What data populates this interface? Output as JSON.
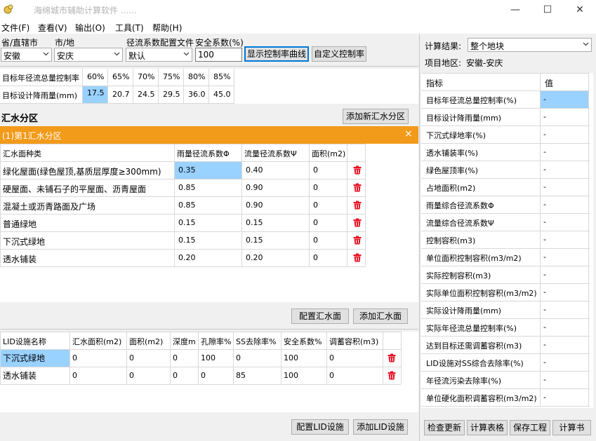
{
  "window": {
    "title": "海绵城市辅助计算软件",
    "title_suffix": "......",
    "minimize": "—",
    "maximize": "☐",
    "close": "✕"
  },
  "menu": [
    "文件(F)",
    "查看(V)",
    "输出(O)",
    "工具(T)",
    "帮助(H)"
  ],
  "toolbar": {
    "province_label": "省/直辖市",
    "province_value": "安徽",
    "city_label": "市/地",
    "city_value": "安庆",
    "coef_label": "径流系数配置文件",
    "coef_value": "默认",
    "safety_label": "安全系数(%)",
    "safety_value": "100",
    "show_curve_button": "显示控制率曲线",
    "custom_rate_button": "自定义控制率"
  },
  "target_table": {
    "row1_label": "目标年径流总量控制率",
    "row2_label": "目标设计降雨量(mm)",
    "rates": [
      "60%",
      "65%",
      "70%",
      "75%",
      "80%",
      "85%"
    ],
    "rainfall": [
      "17.5",
      "20.7",
      "24.5",
      "29.5",
      "36.0",
      "45.0"
    ]
  },
  "catchment": {
    "section_title": "汇水分区",
    "add_button": "添加新汇水分区",
    "zone_title": "(1)第1汇水分区",
    "close_glyph": "×"
  },
  "surface_table": {
    "headers": [
      "汇水面种类",
      "雨量径流系数Φ",
      "流量径流系数Ψ",
      "面积(m2)"
    ],
    "rows": [
      [
        "绿化屋面(绿色屋顶,基质层厚度≥300mm)",
        "0.35",
        "0.40",
        "0"
      ],
      [
        "硬屋面、未铺石子的平屋面、沥青屋面",
        "0.85",
        "0.90",
        "0"
      ],
      [
        "混凝土或沥青路面及广场",
        "0.85",
        "0.90",
        "0"
      ],
      [
        "普通绿地",
        "0.15",
        "0.15",
        "0"
      ],
      [
        "下沉式绿地",
        "0.15",
        "0.15",
        "0"
      ],
      [
        "透水铺装",
        "0.20",
        "0.20",
        "0"
      ]
    ],
    "config_button": "配置汇水面",
    "add_button": "添加汇水面"
  },
  "lid_table": {
    "headers": [
      "LID设施名称",
      "汇水面积(m2)",
      "面积(m2)",
      "深度m",
      "孔隙率%",
      "SS去除率%",
      "安全系数%",
      "调蓄容积(m3)"
    ],
    "rows": [
      [
        "下沉式绿地",
        "0",
        "0",
        "0",
        "100",
        "0",
        "100",
        "0"
      ],
      [
        "透水铺装",
        "0",
        "0",
        "0",
        "0",
        "85",
        "100",
        "0"
      ]
    ],
    "config_button": "配置LID设施",
    "add_button": "添加LID设施"
  },
  "results": {
    "result_label": "计算结果:",
    "result_value": "整个地块",
    "area_label": "项目地区:",
    "area_value": "安徽-安庆",
    "col_index": "指标",
    "col_value": "值",
    "rows": [
      [
        "目标年径流总量控制率(%)",
        "-"
      ],
      [
        "目标设计降雨量(mm)",
        "-"
      ],
      [
        "下沉式绿地率(%)",
        "-"
      ],
      [
        "透水铺装率(%)",
        "-"
      ],
      [
        "绿色屋顶率(%)",
        "-"
      ],
      [
        "占地面积(m2)",
        "-"
      ],
      [
        "雨量综合径流系数Φ",
        "-"
      ],
      [
        "流量综合径流系数Ψ",
        "-"
      ],
      [
        "控制容积(m3)",
        "-"
      ],
      [
        "单位面积控制容积(m3/m2)",
        "-"
      ],
      [
        "实际控制容积(m3)",
        "-"
      ],
      [
        "实际单位面积控制容积(m3/m2)",
        "-"
      ],
      [
        "实际设计降雨量(mm)",
        "-"
      ],
      [
        "实际年径流总量控制率(%)",
        "-"
      ],
      [
        "达到目标还需调蓄容积(m3)",
        "-"
      ],
      [
        "LID设施对SS综合去除率(%)",
        "-"
      ],
      [
        "年径流污染去除率(%)",
        "-"
      ],
      [
        "单位硬化面积调蓄容积(m3/m2)",
        "-"
      ]
    ],
    "buttons": [
      "检查更新",
      "计算表格",
      "保存工程",
      "计算书"
    ]
  },
  "colors": {
    "orange": "#f29a19",
    "selection": "#99d1ff",
    "accent": "#0078d7",
    "trash": "#e81123"
  }
}
